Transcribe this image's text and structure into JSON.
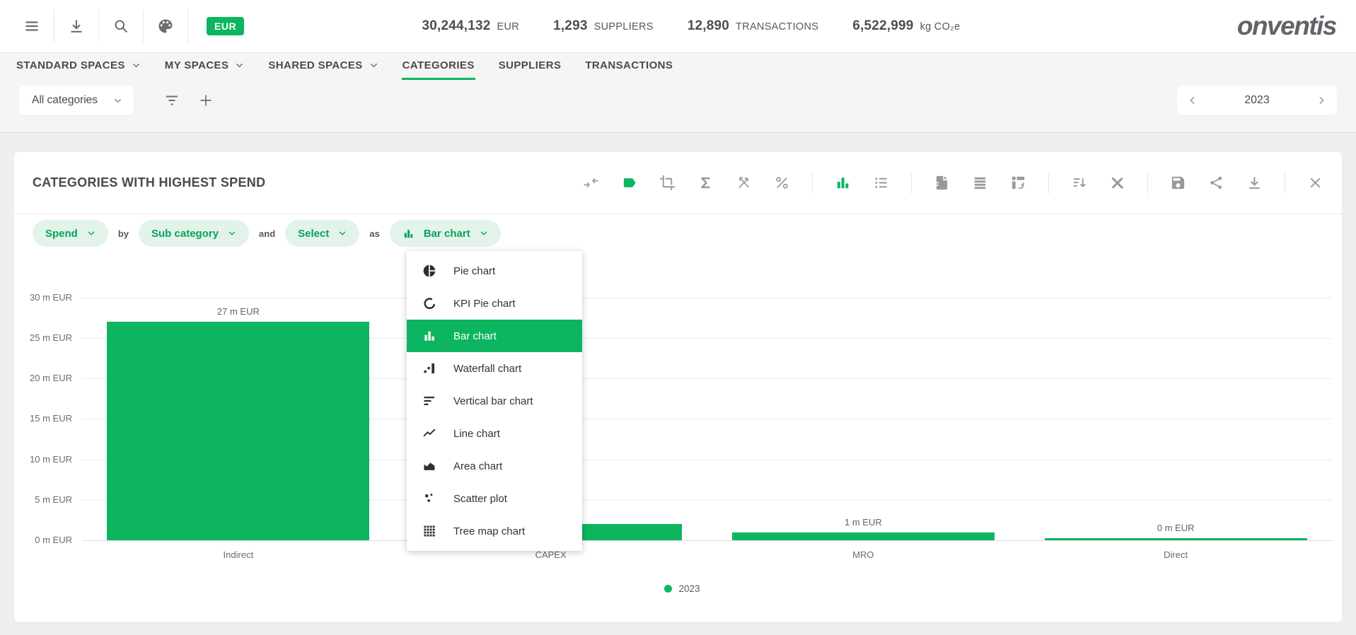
{
  "header": {
    "currency_badge": "EUR",
    "icons": [
      "menu-icon",
      "download-icon",
      "search-icon",
      "palette-icon"
    ],
    "stats": [
      {
        "value": "30,244,132",
        "label": "EUR"
      },
      {
        "value": "1,293",
        "label": "SUPPLIERS"
      },
      {
        "value": "12,890",
        "label": "TRANSACTIONS"
      },
      {
        "value": "6,522,999",
        "label": "kg CO₂e"
      }
    ],
    "logo_text": "onventis"
  },
  "nav": {
    "tabs": [
      {
        "label": "STANDARD SPACES",
        "has_dropdown": true,
        "active": false
      },
      {
        "label": "MY SPACES",
        "has_dropdown": true,
        "active": false
      },
      {
        "label": "SHARED SPACES",
        "has_dropdown": true,
        "active": false
      },
      {
        "label": "CATEGORIES",
        "has_dropdown": false,
        "active": true
      },
      {
        "label": "SUPPLIERS",
        "has_dropdown": false,
        "active": false
      },
      {
        "label": "TRANSACTIONS",
        "has_dropdown": false,
        "active": false
      }
    ]
  },
  "filter_bar": {
    "category_dropdown": "All categories",
    "year_selector": {
      "value": "2023"
    }
  },
  "panel": {
    "title": "CATEGORIES WITH HIGHEST SPEND",
    "toolbar_icons": [
      "merge-columns-icon",
      "label-tag-icon",
      "crop-icon",
      "sum-sigma-icon",
      "axis-swap-off-icon",
      "percent-icon",
      "bar-chart-view-icon",
      "list-view-icon",
      "report-file-icon",
      "table-rows-icon",
      "pivot-table-icon",
      "sort-descending-icon",
      "design-tools-icon",
      "save-icon",
      "share-icon",
      "download-icon",
      "close-icon"
    ],
    "query_builder": {
      "measure": "Spend",
      "connector_1": "by",
      "dimension": "Sub category",
      "connector_2": "and",
      "filter": "Select",
      "connector_3": "as",
      "chart_type": "Bar chart"
    },
    "chart_type_menu": {
      "items": [
        {
          "label": "Pie chart",
          "icon": "pie-chart-icon",
          "selected": false
        },
        {
          "label": "KPI Pie chart",
          "icon": "kpi-pie-chart-icon",
          "selected": false
        },
        {
          "label": "Bar chart",
          "icon": "bar-chart-icon",
          "selected": true
        },
        {
          "label": "Waterfall chart",
          "icon": "waterfall-chart-icon",
          "selected": false
        },
        {
          "label": "Vertical bar chart",
          "icon": "vertical-bar-chart-icon",
          "selected": false
        },
        {
          "label": "Line chart",
          "icon": "line-chart-icon",
          "selected": false
        },
        {
          "label": "Area chart",
          "icon": "area-chart-icon",
          "selected": false
        },
        {
          "label": "Scatter plot",
          "icon": "scatter-plot-icon",
          "selected": false
        },
        {
          "label": "Tree map chart",
          "icon": "tree-map-chart-icon",
          "selected": false
        }
      ]
    },
    "legend": {
      "label": "2023",
      "color": "#0db561"
    }
  },
  "chart_data": {
    "type": "bar",
    "title": "CATEGORIES WITH HIGHEST SPEND",
    "categories": [
      "Indirect",
      "CAPEX",
      "MRO",
      "Direct"
    ],
    "values": [
      27,
      2,
      1,
      0.2
    ],
    "value_labels": [
      "27 m EUR",
      "",
      "1 m EUR",
      "0 m EUR"
    ],
    "unit": "m EUR",
    "ylim": [
      0,
      30
    ],
    "y_ticks": [
      {
        "value": 30,
        "label": "30 m EUR"
      },
      {
        "value": 25,
        "label": "25 m EUR"
      },
      {
        "value": 20,
        "label": "20 m EUR"
      },
      {
        "value": 15,
        "label": "15 m EUR"
      },
      {
        "value": 10,
        "label": "10 m EUR"
      },
      {
        "value": 5,
        "label": "5 m EUR"
      },
      {
        "value": 0,
        "label": "0 m EUR"
      }
    ],
    "series": [
      {
        "name": "2023",
        "color": "#0db561"
      }
    ],
    "grid": true,
    "legend_position": "bottom"
  },
  "colors": {
    "accent_green": "#0db561",
    "pill_background": "#e2f3ea",
    "pill_text": "#0ba259",
    "icon_gray": "#97999b",
    "text_dark": "#4a4a4a"
  }
}
